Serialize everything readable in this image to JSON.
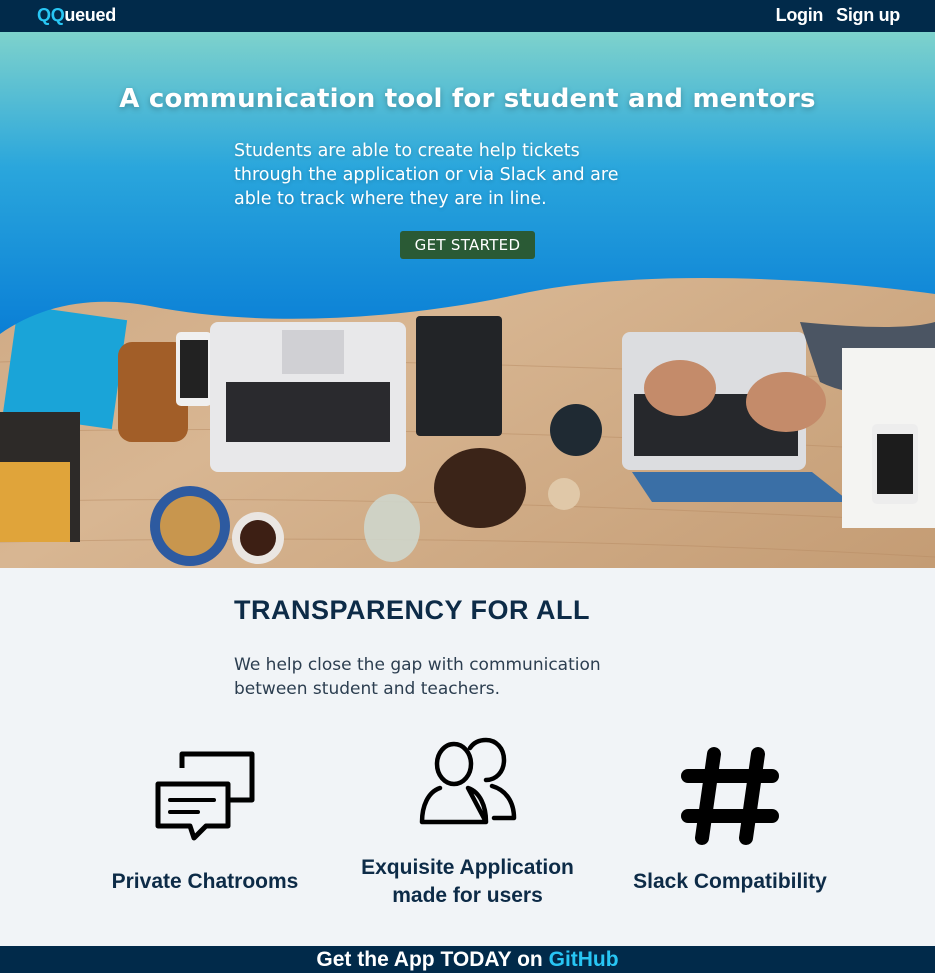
{
  "nav": {
    "logo_accent": "QQ",
    "logo_rest": "ueued",
    "login": "Login",
    "signup": "Sign up"
  },
  "hero": {
    "title": "A communication tool for student and mentors",
    "lines": [
      "Students are able to create help tickets",
      "through the application or via Slack and are",
      "able to track where they are in line."
    ],
    "cta": "GET STARTED"
  },
  "info": {
    "title": "TRANSPARENCY FOR ALL",
    "lines": [
      "We help close the gap with communication",
      "between student and teachers."
    ]
  },
  "features": [
    {
      "icon": "chat-bubbles-icon",
      "label_lines": [
        "Private Chatrooms"
      ]
    },
    {
      "icon": "users-icon",
      "label_lines": [
        "Exquisite Application",
        "made for users"
      ]
    },
    {
      "icon": "slack-icon",
      "label_lines": [
        "Slack Compatibility"
      ]
    }
  ],
  "footer": {
    "text": "Get the App TODAY on ",
    "link": "GitHub"
  },
  "colors": {
    "nav_bg": "#012a4a",
    "accent": "#28c6f4",
    "cta_bg": "#2a5a35",
    "hero_gradient_top": "#7ed2cc",
    "hero_gradient_bottom": "#0a84dc",
    "heading": "#0d2b47"
  }
}
